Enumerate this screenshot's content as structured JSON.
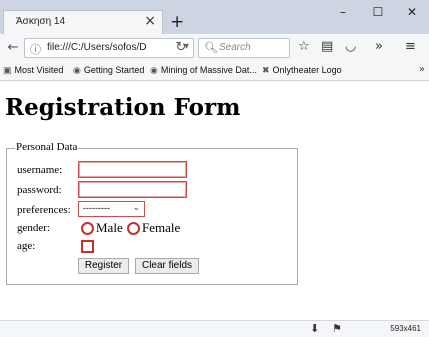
{
  "browser": {
    "tab_title": "Άσκηση 14",
    "url": "file:///C:/Users/sofos/D",
    "search_placeholder": "Search",
    "bookmarks": [
      {
        "label": "Most Visited",
        "icon": "bookmark-folder-icon"
      },
      {
        "label": "Getting Started",
        "icon": "firefox-icon"
      },
      {
        "label": "Mining of Massive Dat...",
        "icon": "globe-icon"
      },
      {
        "label": "Onlytheater Logo",
        "icon": "theater-icon"
      }
    ]
  },
  "page": {
    "title": "Registration Form",
    "fieldset_legend": "Personal Data",
    "fields": {
      "username_label": "username:",
      "password_label": "password:",
      "preferences_label": "preferences:",
      "preferences_value": "---------",
      "gender_label": "gender:",
      "gender_male": "Male",
      "gender_female": "Female",
      "age_label": "age:"
    },
    "buttons": {
      "register": "Register",
      "clear": "Clear fields"
    }
  },
  "status": {
    "window_size": "593x461"
  },
  "colors": {
    "invalid_border": "#d14b4b",
    "tabstrip": "#ccd5e1",
    "chrome": "#f5f6f7"
  }
}
